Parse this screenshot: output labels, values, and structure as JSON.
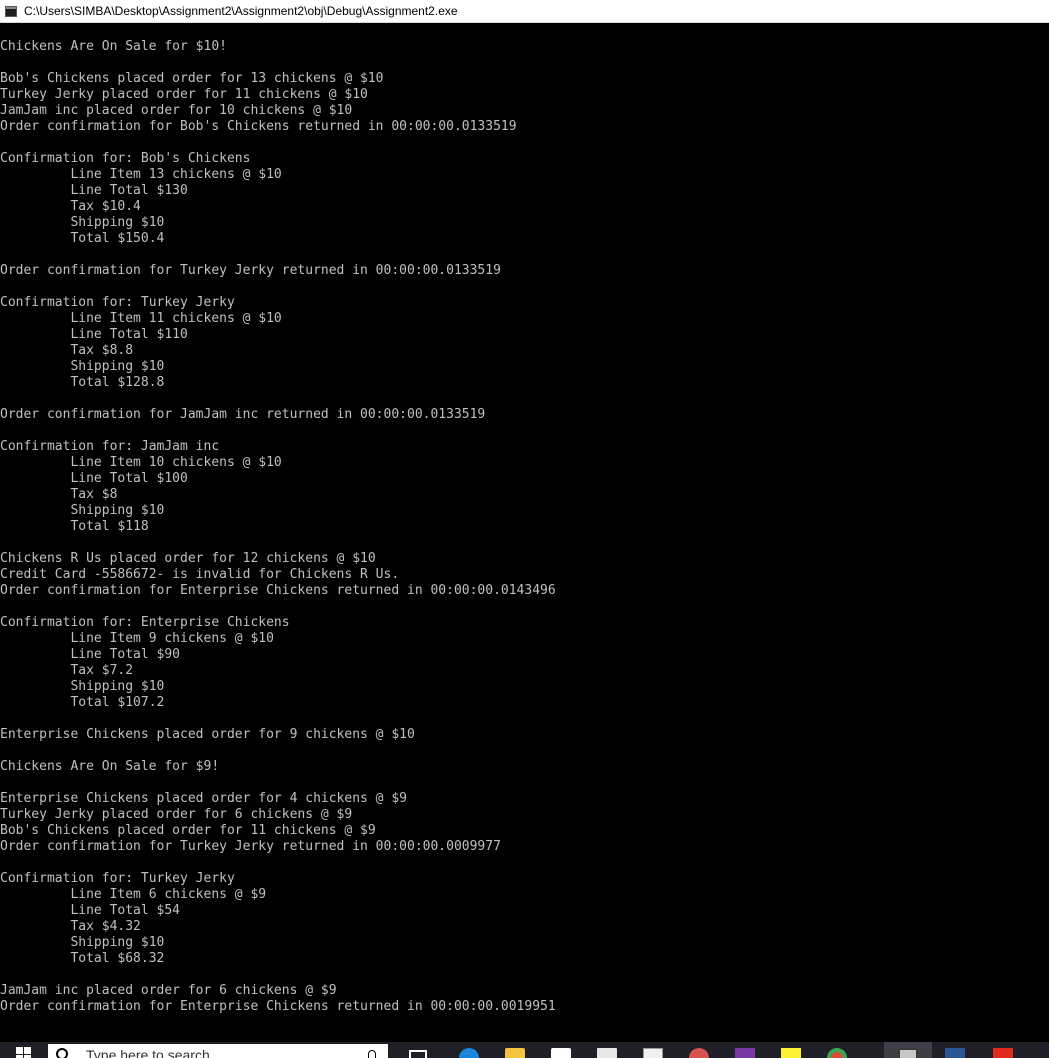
{
  "window": {
    "title": "C:\\Users\\SIMBA\\Desktop\\Assignment2\\Assignment2\\obj\\Debug\\Assignment2.exe",
    "icon": "console-app-icon"
  },
  "console": {
    "lines": [
      "Chickens Are On Sale for $10!",
      "",
      "Bob's Chickens placed order for 13 chickens @ $10",
      "Turkey Jerky placed order for 11 chickens @ $10",
      "JamJam inc placed order for 10 chickens @ $10",
      "Order confirmation for Bob's Chickens returned in 00:00:00.0133519",
      "",
      "Confirmation for: Bob's Chickens",
      "         Line Item 13 chickens @ $10",
      "         Line Total $130",
      "         Tax $10.4",
      "         Shipping $10",
      "         Total $150.4",
      "",
      "Order confirmation for Turkey Jerky returned in 00:00:00.0133519",
      "",
      "Confirmation for: Turkey Jerky",
      "         Line Item 11 chickens @ $10",
      "         Line Total $110",
      "         Tax $8.8",
      "         Shipping $10",
      "         Total $128.8",
      "",
      "Order confirmation for JamJam inc returned in 00:00:00.0133519",
      "",
      "Confirmation for: JamJam inc",
      "         Line Item 10 chickens @ $10",
      "         Line Total $100",
      "         Tax $8",
      "         Shipping $10",
      "         Total $118",
      "",
      "Chickens R Us placed order for 12 chickens @ $10",
      "Credit Card -5586672- is invalid for Chickens R Us.",
      "Order confirmation for Enterprise Chickens returned in 00:00:00.0143496",
      "",
      "Confirmation for: Enterprise Chickens",
      "         Line Item 9 chickens @ $10",
      "         Line Total $90",
      "         Tax $7.2",
      "         Shipping $10",
      "         Total $107.2",
      "",
      "Enterprise Chickens placed order for 9 chickens @ $10",
      "",
      "Chickens Are On Sale for $9!",
      "",
      "Enterprise Chickens placed order for 4 chickens @ $9",
      "Turkey Jerky placed order for 6 chickens @ $9",
      "Bob's Chickens placed order for 11 chickens @ $9",
      "Order confirmation for Turkey Jerky returned in 00:00:00.0009977",
      "",
      "Confirmation for: Turkey Jerky",
      "         Line Item 6 chickens @ $9",
      "         Line Total $54",
      "         Tax $4.32",
      "         Shipping $10",
      "         Total $68.32",
      "",
      "JamJam inc placed order for 6 chickens @ $9",
      "Order confirmation for Enterprise Chickens returned in 00:00:00.0019951"
    ]
  },
  "taskbar": {
    "search_placeholder": "Type here to search",
    "items": [
      {
        "name": "task-view-icon"
      },
      {
        "name": "edge-icon"
      },
      {
        "name": "file-explorer-icon"
      },
      {
        "name": "store-icon"
      },
      {
        "name": "graduation-cap-icon"
      },
      {
        "name": "notepad-icon"
      },
      {
        "name": "paint-icon"
      },
      {
        "name": "onenote-icon"
      },
      {
        "name": "sticky-notes-icon"
      },
      {
        "name": "chrome-icon"
      },
      {
        "name": "console-app-icon"
      },
      {
        "name": "word-icon"
      },
      {
        "name": "pdf-icon"
      }
    ]
  },
  "colors": {
    "console_background": "#000000",
    "console_text": "#c0c0c0",
    "titlebar_background": "#ffffff",
    "taskbar_background": "#1f1f27"
  }
}
